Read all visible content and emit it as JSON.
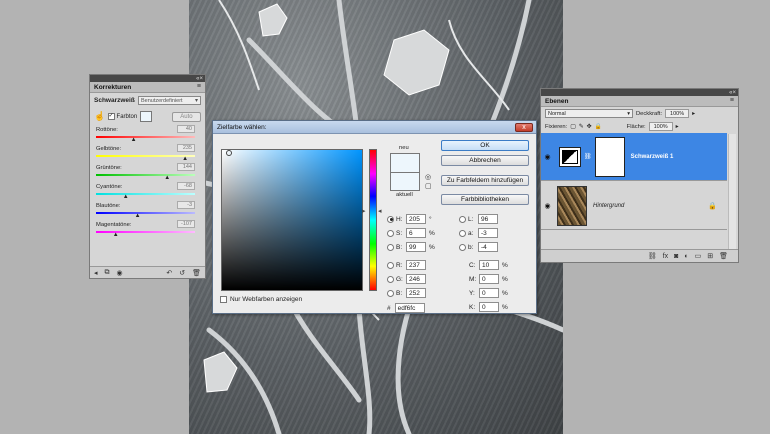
{
  "korrekturen": {
    "panel_title": "Korrekturen",
    "header_label": "Schwarzweiß",
    "preset_value": "Benutzerdefiniert",
    "tint_checkbox_label": "Farbton",
    "auto_label": "Auto",
    "sliders": [
      {
        "label": "Rottöne:",
        "value": "40",
        "color_from": "#ff0000",
        "color_to": "#ffbbbb",
        "fraction": 0.38
      },
      {
        "label": "Gelbtöne:",
        "value": "235",
        "color_from": "#ffff00",
        "color_to": "#ffffbb",
        "fraction": 0.9
      },
      {
        "label": "Grüntöne:",
        "value": "144",
        "color_from": "#00c000",
        "color_to": "#bbffbb",
        "fraction": 0.72
      },
      {
        "label": "Cyantöne:",
        "value": "-68",
        "color_from": "#00e0e0",
        "color_to": "#bbffff",
        "fraction": 0.3
      },
      {
        "label": "Blautöne:",
        "value": "-3",
        "color_from": "#0000ff",
        "color_to": "#bbbbff",
        "fraction": 0.42
      },
      {
        "label": "Magentatöne:",
        "value": "-107",
        "color_from": "#ff00ff",
        "color_to": "#ffbbff",
        "fraction": 0.2
      }
    ]
  },
  "ebenen": {
    "panel_title": "Ebenen",
    "blend_mode": "Normal",
    "opacity_label": "Deckkraft:",
    "opacity_value": "100%",
    "lock_label": "Fixieren:",
    "fill_label": "Fläche:",
    "fill_value": "100%",
    "layers": [
      {
        "name": "Schwarzweiß 1",
        "active": true
      },
      {
        "name": "Hintergrund",
        "active": false
      }
    ]
  },
  "picker": {
    "title": "Zielfarbe wählen:",
    "close_label": "x",
    "new_label": "neu",
    "current_label": "aktuell",
    "buttons": {
      "ok": "OK",
      "cancel": "Abbrechen",
      "add_swatch": "Zu Farbfeldern hinzufügen",
      "libraries": "Farbbibliotheken"
    },
    "hsb": [
      {
        "label": "H:",
        "value": "205",
        "unit": "°",
        "selected": true
      },
      {
        "label": "S:",
        "value": "6",
        "unit": "%",
        "selected": false
      },
      {
        "label": "B:",
        "value": "99",
        "unit": "%",
        "selected": false
      }
    ],
    "rgb": [
      {
        "label": "R:",
        "value": "237"
      },
      {
        "label": "G:",
        "value": "246"
      },
      {
        "label": "B:",
        "value": "252"
      }
    ],
    "lab": [
      {
        "label": "L:",
        "value": "96"
      },
      {
        "label": "a:",
        "value": "-3"
      },
      {
        "label": "b:",
        "value": "-4"
      }
    ],
    "cmyk": [
      {
        "label": "C:",
        "value": "10",
        "unit": "%"
      },
      {
        "label": "M:",
        "value": "0",
        "unit": "%"
      },
      {
        "label": "Y:",
        "value": "0",
        "unit": "%"
      },
      {
        "label": "K:",
        "value": "0",
        "unit": "%"
      }
    ],
    "hex_label": "#",
    "hex_value": "edf6fc",
    "web_colors_label": "Nur Webfarben anzeigen",
    "selected_color": "#edf6fc"
  }
}
